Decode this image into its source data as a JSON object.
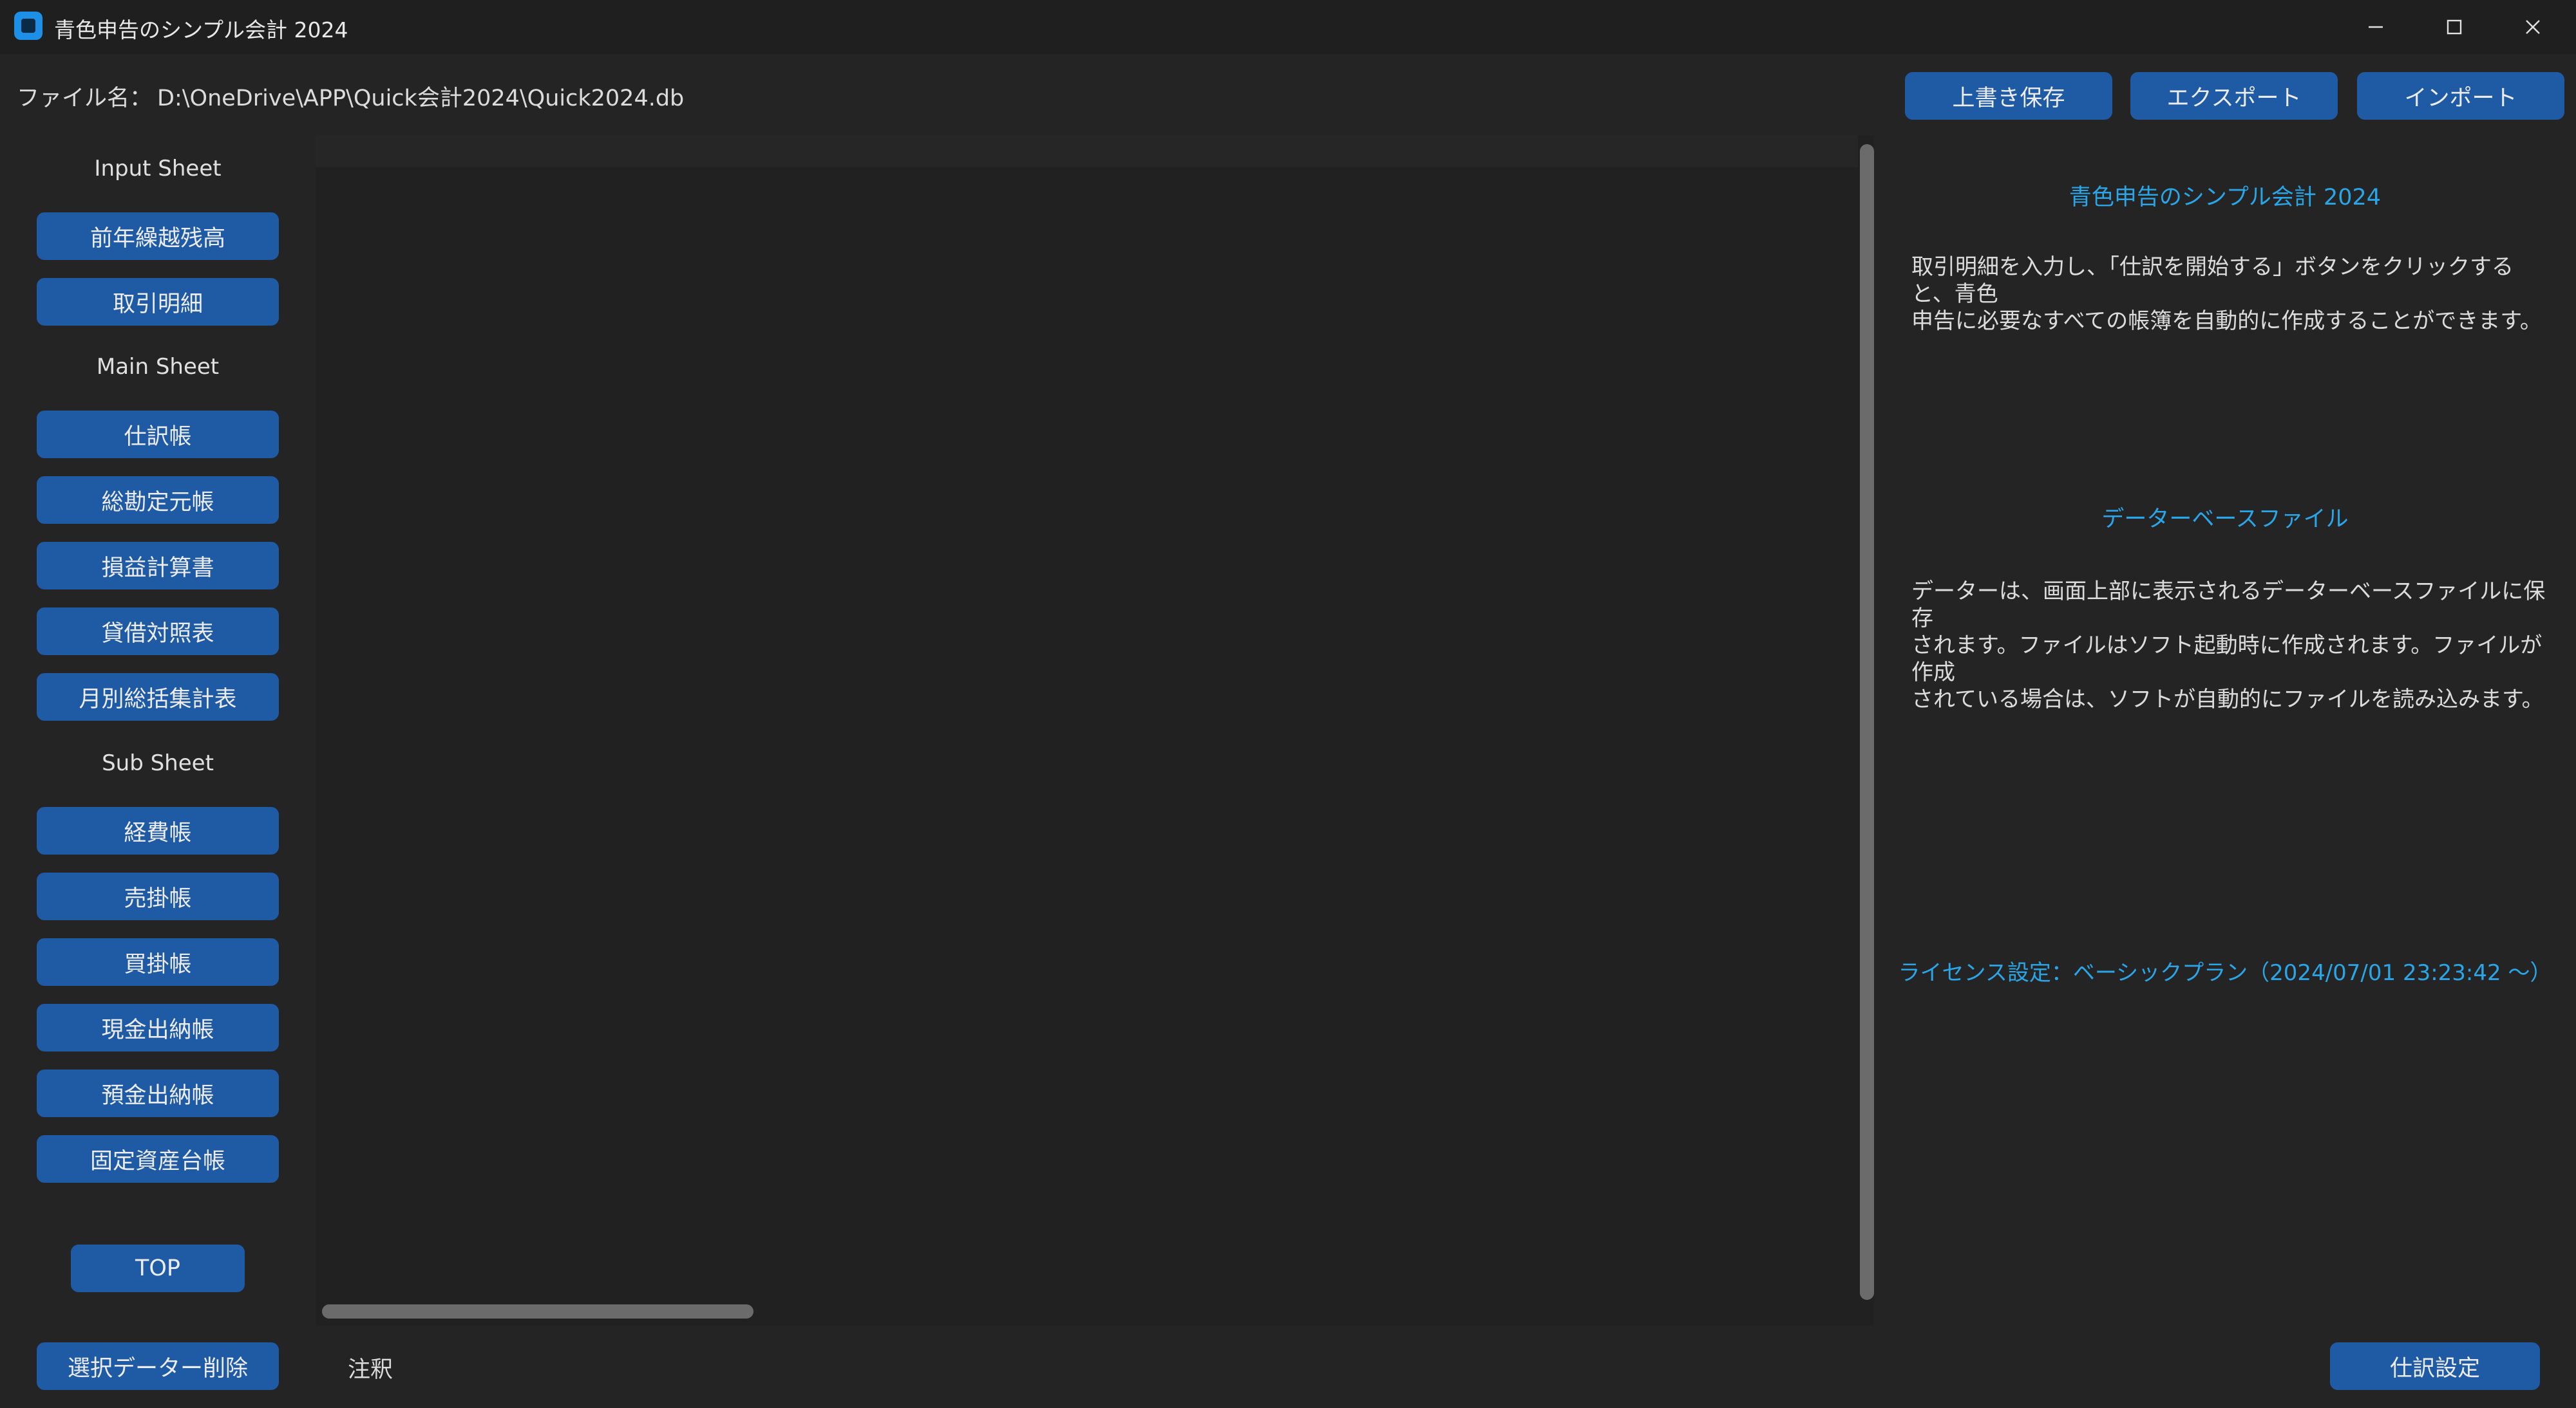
{
  "window": {
    "title": "青色申告のシンプル会計 2024"
  },
  "toolbar": {
    "file_label": "ファイル名：",
    "file_path": "D:\\OneDrive\\APP\\Quick会計2024\\Quick2024.db",
    "overwrite_save": "上書き保存",
    "export": "エクスポート",
    "import": "インポート"
  },
  "sidebar": {
    "input_heading": "Input Sheet",
    "input_items": [
      "前年繰越残高",
      "取引明細"
    ],
    "main_heading": "Main Sheet",
    "main_items": [
      "仕訳帳",
      "総勘定元帳",
      "損益計算書",
      "貸借対照表",
      "月別総括集計表"
    ],
    "sub_heading": "Sub Sheet",
    "sub_items": [
      "経費帳",
      "売掛帳",
      "買掛帳",
      "現金出納帳",
      "預金出納帳",
      "固定資産台帳"
    ],
    "top_button": "TOP"
  },
  "info": {
    "title": "青色申告のシンプル会計 2024",
    "intro_line1": "取引明細を入力し、「仕訳を開始する」ボタンをクリックすると、青色",
    "intro_line2": "申告に必要なすべての帳簿を自動的に作成することができます。",
    "db_title": "データーベースファイル",
    "db_line1": "データーは、画面上部に表示されるデーターベースファイルに保存",
    "db_line2": "されます。ファイルはソフト起動時に作成されます。ファイルが作成",
    "db_line3": "されている場合は、ソフトが自動的にファイルを読み込みます。",
    "license": "ライセンス設定：ベーシックプラン（2024/07/01 23:23:42 ～）"
  },
  "bottom": {
    "delete_button": "選択データー削除",
    "note_label": "注釈",
    "journal_settings": "仕訳設定"
  },
  "colors": {
    "background": "#242424",
    "button": "#1f5aa5",
    "accent_text": "#2aa6e8",
    "app_icon": "#1e8fe6"
  }
}
